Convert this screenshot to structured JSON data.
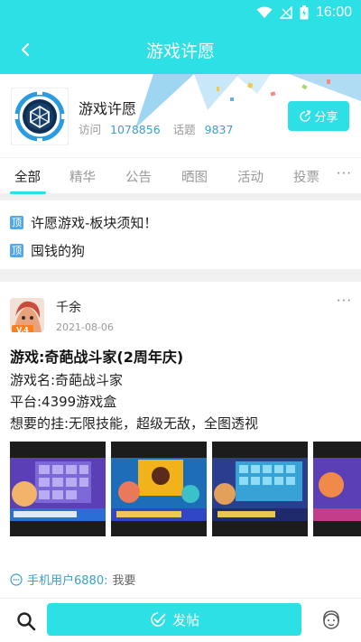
{
  "status_bar": {
    "time": "16:00"
  },
  "header": {
    "title": "游戏许愿"
  },
  "forum": {
    "name": "游戏许愿",
    "visits_label": "访问",
    "visits": "1078856",
    "topics_label": "话题",
    "topics": "9837",
    "share_label": "分享"
  },
  "tabs": [
    "全部",
    "精华",
    "公告",
    "晒图",
    "活动",
    "投票"
  ],
  "pinned": {
    "badge": "顶",
    "items": [
      "许愿游戏-板块须知！",
      "囤钱的狗"
    ]
  },
  "post": {
    "author": "千余",
    "level": "V.4",
    "date": "2021-08-06",
    "title": "游戏:奇葩战斗家(2周年庆)",
    "lines": [
      "游戏名:奇葩战斗家",
      "平台:4399游戏盒",
      "想要的挂:无限技能，超级无敌，全图透视"
    ],
    "reply_user": "手机用户6880:",
    "reply_text": "我要"
  },
  "bottom_bar": {
    "post_label": "发帖"
  },
  "colors": {
    "accent": "#2de0e6",
    "link": "#3aa0c8",
    "pin": "#52a8e8"
  }
}
